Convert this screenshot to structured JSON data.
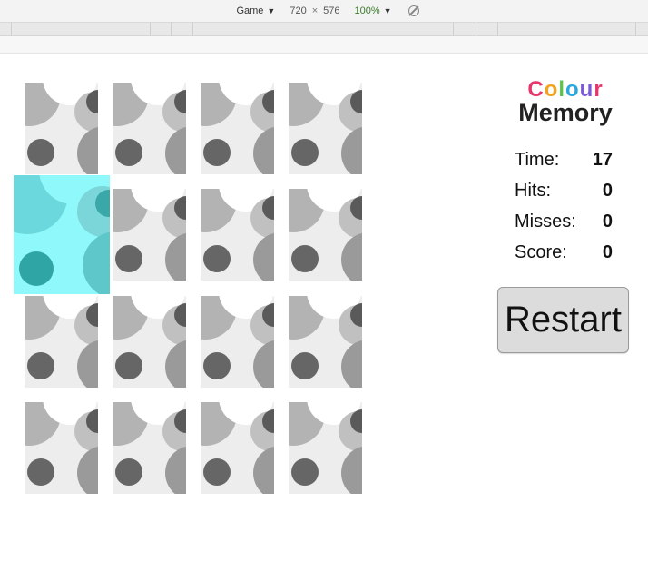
{
  "devtools": {
    "device": "Game",
    "width": "720",
    "times": "×",
    "height": "576",
    "zoom": "100%"
  },
  "game": {
    "logo_line1": [
      "C",
      "o",
      "l",
      "o",
      "u",
      "r"
    ],
    "logo_line1_colors": [
      "#e8356b",
      "#f3a21c",
      "#5cc34a",
      "#2aa7e0",
      "#7b5bd6",
      "#e8356b"
    ],
    "logo_line2": "Memory",
    "stats": [
      {
        "label": "Time:",
        "value": "17"
      },
      {
        "label": "Hits:",
        "value": "0"
      },
      {
        "label": "Misses:",
        "value": "0"
      },
      {
        "label": "Score:",
        "value": "0"
      }
    ],
    "restart_label": "Restart",
    "cards": [
      {
        "state": "hidden"
      },
      {
        "state": "hidden"
      },
      {
        "state": "hidden"
      },
      {
        "state": "hidden"
      },
      {
        "state": "flipped",
        "color": "#8ff8fb"
      },
      {
        "state": "hidden"
      },
      {
        "state": "hidden"
      },
      {
        "state": "hidden"
      },
      {
        "state": "hidden"
      },
      {
        "state": "hidden"
      },
      {
        "state": "hidden"
      },
      {
        "state": "hidden"
      },
      {
        "state": "hidden"
      },
      {
        "state": "hidden"
      },
      {
        "state": "hidden"
      },
      {
        "state": "hidden"
      }
    ]
  }
}
